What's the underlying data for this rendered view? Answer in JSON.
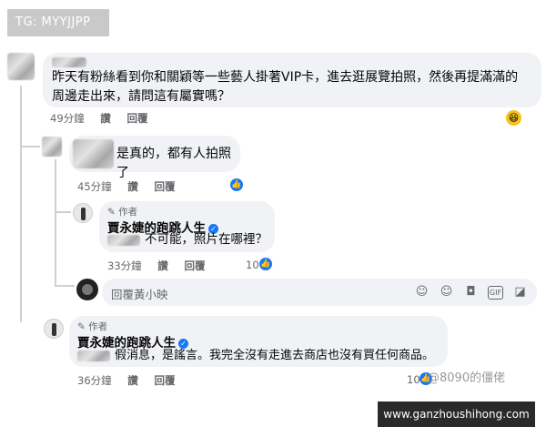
{
  "tag": "TG: MYYJJPP",
  "comment1": {
    "text": "昨天有粉絲看到你和關穎等一些藝人掛著VIP卡，進去逛展覽拍照，然後再提滿滿的周邊走出來，請問這有屬實嗎？",
    "time": "49分鐘",
    "like": "讚",
    "reply": "回覆",
    "reaction": "laughing-emoji"
  },
  "comment2": {
    "text": "是真的，都有人拍照了",
    "time": "45分鐘",
    "like": "讚",
    "reply": "回覆"
  },
  "comment3": {
    "author_label": "作者",
    "name": "賈永婕的跑跳人生",
    "text": "不可能，照片在哪裡？",
    "time": "33分鐘",
    "like": "讚",
    "reply": "回覆",
    "count": "10"
  },
  "reply_box": {
    "placeholder": "回覆黃小映"
  },
  "comment4": {
    "author_label": "作者",
    "name": "賈永婕的跑跳人生",
    "text": "假消息，是謠言。我完全沒有走進去商店也沒有買任何商品。",
    "time": "36分鐘",
    "like": "讚",
    "reply": "回覆",
    "count": "10"
  },
  "watermark": "@8090的僵佬",
  "site_url": "www.ganzhoushihong.com",
  "colors": {
    "accent": "#1877f2",
    "bubble": "#f0f2f5",
    "meta": "#65676b"
  }
}
